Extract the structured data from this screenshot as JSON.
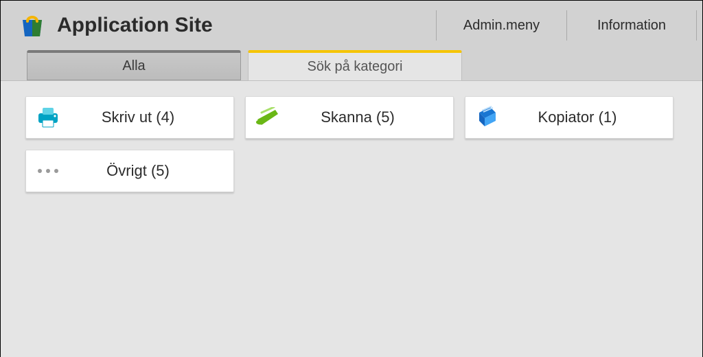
{
  "header": {
    "title": "Application Site",
    "buttons": {
      "admin": "Admin.meny",
      "info": "Information"
    }
  },
  "tabs": {
    "all": "Alla",
    "search_category": "Sök på kategori"
  },
  "categories": [
    {
      "icon": "printer",
      "label": "Skriv ut (4)"
    },
    {
      "icon": "scanner",
      "label": "Skanna (5)"
    },
    {
      "icon": "copier",
      "label": "Kopiator (1)"
    },
    {
      "icon": "other",
      "label": "Övrigt (5)"
    }
  ],
  "colors": {
    "accent_yellow": "#f5c400",
    "icon_print": "#00a3c4",
    "icon_scan": "#6ab716",
    "icon_copy": "#1976d2"
  }
}
